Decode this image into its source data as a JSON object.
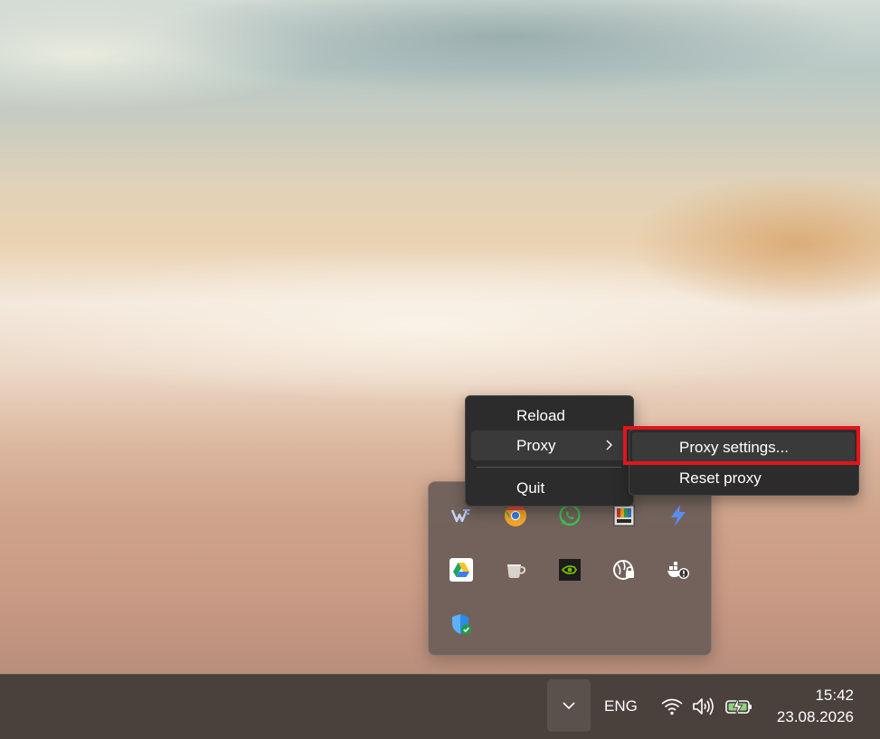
{
  "context_menu": {
    "items": [
      {
        "label": "Reload"
      },
      {
        "label": "Proxy",
        "has_submenu": true
      },
      {
        "label": "Quit"
      }
    ]
  },
  "submenu": {
    "items": [
      {
        "label": "Proxy settings...",
        "highlighted": true
      },
      {
        "label": "Reset proxy"
      }
    ],
    "highlight_color": "#e3141b"
  },
  "tray_flyout": {
    "icons": [
      "winrar-icon",
      "google-chrome-canary-icon",
      "whatsapp-icon",
      "colorful-app-icon",
      "lightning-app-icon",
      "google-drive-icon",
      "coffee-cup-icon",
      "nvidia-icon",
      "vpn-lock-icon",
      "docker-warning-icon",
      "windows-security-icon"
    ]
  },
  "taskbar": {
    "language": "ENG",
    "time": "15:42",
    "date": "23.08.2026",
    "status_icons": [
      "wifi-icon",
      "volume-icon",
      "battery-charging-icon"
    ]
  }
}
